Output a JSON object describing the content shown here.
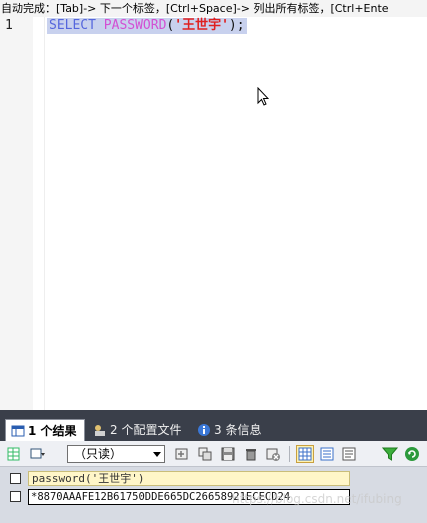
{
  "hint_bar": {
    "text": "自动完成：[Tab]-> 下一个标签，[Ctrl+Space]-> 列出所有标签，[Ctrl+Ente"
  },
  "editor": {
    "line_number": "1",
    "code": {
      "keyword": "SELECT",
      "function": "PASSWORD",
      "open_paren": "(",
      "string": "'王世宇'",
      "close": ");"
    }
  },
  "results": {
    "tabs": [
      {
        "label": "1 个结果",
        "icon": "table-icon",
        "active": true
      },
      {
        "label": "2 个配置文件",
        "icon": "profile-icon",
        "active": false
      },
      {
        "label": "3 条信息",
        "icon": "info-icon",
        "active": false
      }
    ],
    "toolbar": {
      "readonly_select": "（只读）"
    },
    "grid": {
      "column_header": "password('王世宇')",
      "rows": [
        "*8870AAAFE12B61750DDE665DC26658921ECECD24"
      ]
    }
  },
  "watermark": "https://blog.csdn.net/ifubing",
  "colors": {
    "keyword": "#5566dd",
    "function": "#d34fd3",
    "string": "#e02020",
    "line_highlight": "#c8d1ee",
    "tab_strip": "#3a3f4a"
  }
}
